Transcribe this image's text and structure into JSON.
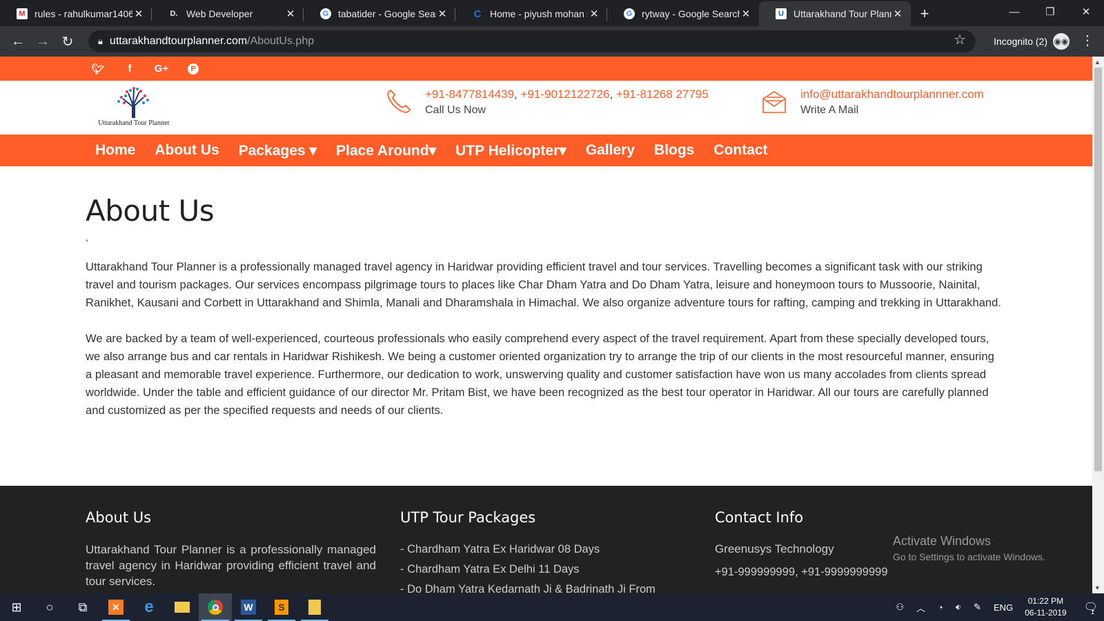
{
  "browser": {
    "tabs": [
      {
        "title": "rules - rahulkumar1406",
        "icon": "gmail-icon",
        "color": "#d93025",
        "glyph": "M"
      },
      {
        "title": "Web Developer",
        "icon": "dev-icon",
        "color": "#e8eaed",
        "glyph": "D."
      },
      {
        "title": "tabatider - Google Sear",
        "icon": "google-icon",
        "color": "#4285f4",
        "glyph": "G"
      },
      {
        "title": "Home - piyush mohan s",
        "icon": "site-icon",
        "color": "#1a73e8",
        "glyph": "C"
      },
      {
        "title": "rytway - Google Search",
        "icon": "google-icon",
        "color": "#4285f4",
        "glyph": "G"
      },
      {
        "title": "Uttarakhand Tour Plann",
        "icon": "site-icon",
        "color": "#1565c0",
        "glyph": "U"
      }
    ],
    "new_tab": "+",
    "url_host": "uttarakhandtourplanner.com",
    "url_path": "/AboutUs.php",
    "incognito_label": "Incognito (2)"
  },
  "site": {
    "social": [
      "twitter-icon",
      "facebook-icon",
      "google-plus-icon",
      "pinterest-icon"
    ],
    "social_glyphs": [
      "t",
      "f",
      "G+",
      "P"
    ],
    "logo_text": "Uttarakhand Tour Planner",
    "phones": [
      {
        "text": "+91-8477814439",
        "sep": ", "
      },
      {
        "text": "+91-9012122726",
        "sep": ", "
      },
      {
        "text": "+91-81268 27795",
        "sep": ""
      }
    ],
    "phone_sub": "Call Us Now",
    "email": "info@uttarakhandtourplannner.com",
    "email_sub": "Write A Mail",
    "nav": [
      {
        "label": "Home"
      },
      {
        "label": "About Us"
      },
      {
        "label": "Packages ▾"
      },
      {
        "label": "Place Around▾"
      },
      {
        "label": "UTP Helicopter▾"
      },
      {
        "label": "Gallery"
      },
      {
        "label": "Blogs"
      },
      {
        "label": "Contact"
      }
    ],
    "brand_color": "#fe5d27"
  },
  "page": {
    "title": "About Us",
    "comma": ",",
    "para1": "Uttarakhand Tour Planner is a professionally managed travel agency in Haridwar providing efficient travel and tour services. Travelling becomes a significant task with our striking travel and tourism packages. Our services encompass pilgrimage tours to places like Char Dham Yatra and Do Dham Yatra, leisure and honeymoon tours to Mussoorie, Nainital, Ranikhet, Kausani and Corbett in Uttarakhand and Shimla, Manali and Dharamshala in Himachal. We also organize adventure tours for rafting, camping and trekking in Uttarakhand.",
    "para2": "We are backed by a team of well-experienced, courteous professionals who easily comprehend every aspect of the travel requirement. Apart from these specially developed tours, we also arrange bus and car rentals in Haridwar Rishikesh. We being a customer oriented organization try to arrange the trip of our clients in the most resourceful manner, ensuring a pleasant and memorable travel experience. Furthermore, our dedication to work, unswerving quality and customer satisfaction have won us many accolades from clients spread worldwide. Under the table and efficient guidance of our director Mr. Pritam Bist, we have been recognized as the best tour operator in Haridwar. All our tours are carefully planned and customized as per the specified requests and needs of our clients."
  },
  "footer": {
    "about_title": "About Us",
    "about_text": "Uttarakhand Tour Planner is a professionally managed travel agency in Haridwar providing efficient travel and tour services.",
    "packages_title": "UTP Tour Packages",
    "packages": [
      "Chardham Yatra Ex Haridwar 08 Days",
      "Chardham Yatra Ex Delhi 11 Days",
      "Do Dham Yatra Kedarnath Ji & Badrinath Ji From"
    ],
    "contact_title": "Contact Info",
    "company": "Greenusys Technology",
    "phones": "+91-999999999, +91-9999999999"
  },
  "windows": {
    "activate_title": "Activate Windows",
    "activate_sub": "Go to Settings to activate Windows.",
    "lang": "ENG",
    "time": "01:22 PM",
    "date": "06-11-2019",
    "notif_count": "1"
  }
}
